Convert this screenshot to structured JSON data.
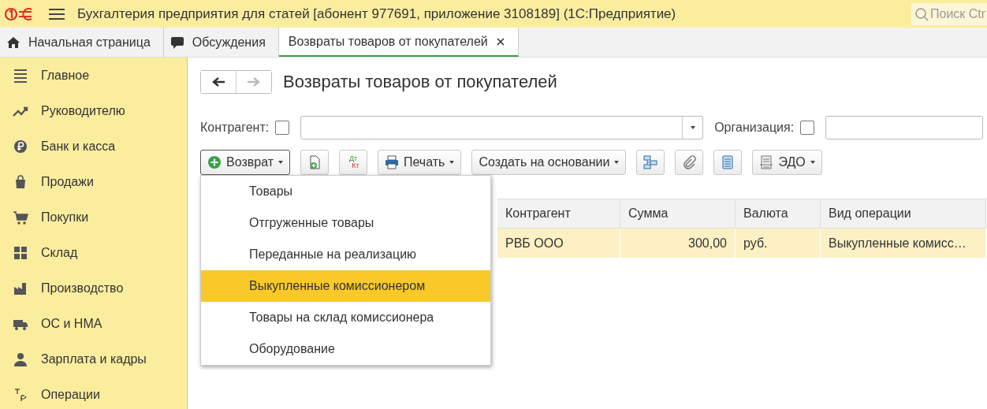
{
  "window": {
    "title": "Бухгалтерия предприятия для статей [абонент 977691, приложение 3108189]  (1С:Предприятие)"
  },
  "search": {
    "placeholder": "Поиск Ctr"
  },
  "tabs": [
    {
      "label": "Начальная страница",
      "selected": false,
      "closable": false
    },
    {
      "label": "Обсуждения",
      "selected": false,
      "closable": false
    },
    {
      "label": "Возвраты товаров от покупателей",
      "selected": true,
      "closable": true
    }
  ],
  "sidebar": {
    "items": [
      {
        "label": "Главное"
      },
      {
        "label": "Руководителю"
      },
      {
        "label": "Банк и касса"
      },
      {
        "label": "Продажи"
      },
      {
        "label": "Покупки"
      },
      {
        "label": "Склад"
      },
      {
        "label": "Производство"
      },
      {
        "label": "ОС и НМА"
      },
      {
        "label": "Зарплата и кадры"
      },
      {
        "label": "Операции"
      }
    ]
  },
  "page": {
    "title": "Возвраты товаров от покупателей"
  },
  "filters": [
    {
      "label": "Контрагент:",
      "checked": false
    },
    {
      "label": "Организация:",
      "checked": false
    }
  ],
  "toolbar": [
    {
      "kind": "menu",
      "label": "Возврат",
      "pressed": true
    },
    {
      "kind": "icon-add"
    },
    {
      "kind": "dtkt",
      "top": "Дт",
      "bottom": "Кт"
    },
    {
      "kind": "menu",
      "label": "Печать",
      "pressed": false
    },
    {
      "kind": "menu",
      "label": "Создать на основании",
      "pressed": false
    },
    {
      "kind": "icon-structure"
    },
    {
      "kind": "icon-clip"
    },
    {
      "kind": "icon-list"
    },
    {
      "kind": "menu",
      "label": "ЭДО",
      "pressed": false
    }
  ],
  "menu": {
    "items": [
      {
        "label": "Товары",
        "selected": false
      },
      {
        "label": "Отгруженные товары",
        "selected": false
      },
      {
        "label": "Переданные на реализацию",
        "selected": false
      },
      {
        "label": "Выкупленные комиссионером",
        "selected": true
      },
      {
        "label": "Товары на склад комиссионера",
        "selected": false
      },
      {
        "label": "Оборудование",
        "selected": false
      }
    ]
  },
  "table": {
    "columns": [
      "Контрагент",
      "Сумма",
      "Валюта",
      "Вид операции"
    ],
    "rows": [
      {
        "selected": true,
        "cells": [
          "РВБ ООО",
          "300,00",
          "руб.",
          "Выкупленные комисс…"
        ]
      }
    ]
  }
}
